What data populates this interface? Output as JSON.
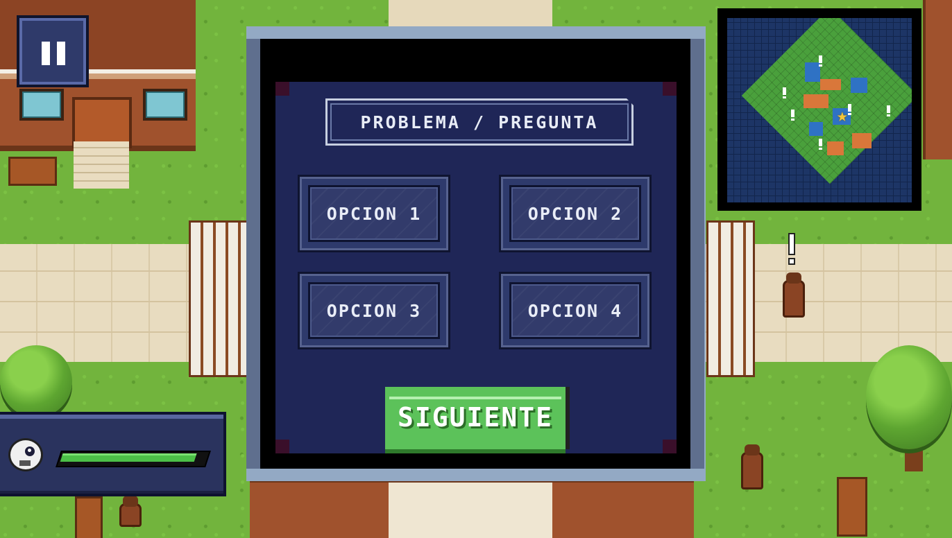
{
  "hud": {
    "pause_icon": "pause-icon",
    "minimap": {
      "player_marker": "★",
      "quest_marker": "!"
    },
    "player": {
      "avatar_icon": "bird-avatar-icon",
      "health_fraction": 0.93,
      "health_color": "#4cc048"
    }
  },
  "dialog": {
    "question": "PROBLEMA / PREGUNTA",
    "options": [
      {
        "label": "OPCION 1"
      },
      {
        "label": "OPCION 2"
      },
      {
        "label": "OPCION 3"
      },
      {
        "label": "OPCION 4"
      }
    ],
    "next_label": "SIGUIENTE",
    "next_color": "#5cc25a",
    "panel_color": "#1f2657",
    "frame_color": "#93a9c4"
  },
  "world": {
    "npc_alert_marker": "!"
  }
}
